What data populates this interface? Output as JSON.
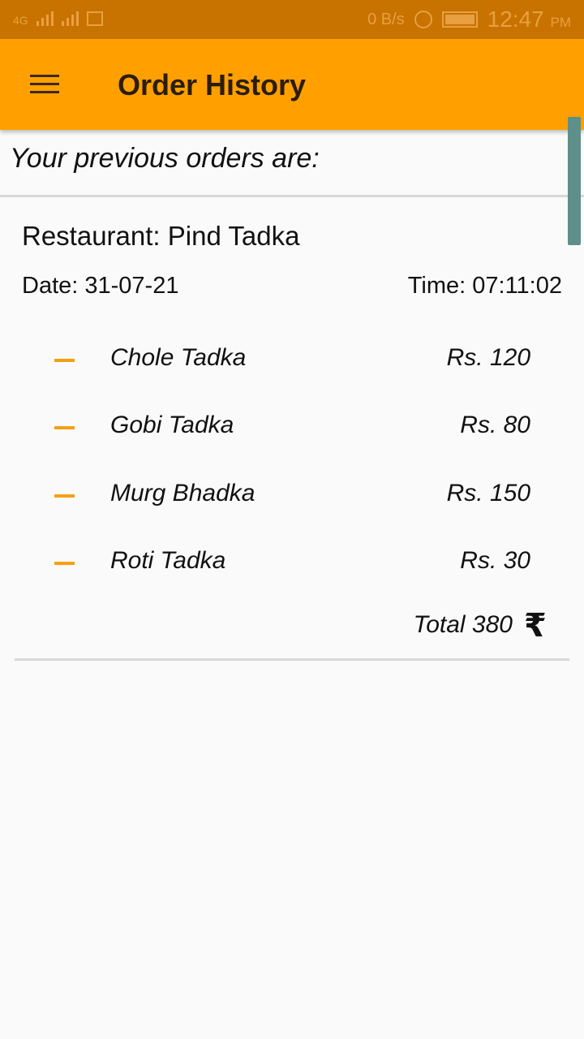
{
  "status_bar": {
    "network": "4G",
    "speed": "0 B/s",
    "time": "12:47",
    "ampm": "PM"
  },
  "app_bar": {
    "title": "Order History",
    "menu_icon": "hamburger-menu-icon"
  },
  "header": {
    "subtitle": "Your previous orders are:"
  },
  "order": {
    "restaurant": "Restaurant: Pind Tadka",
    "date": "Date: 31-07-21",
    "time": "Time: 07:11:02",
    "items": [
      {
        "name": "Chole Tadka",
        "price": "Rs. 120"
      },
      {
        "name": "Gobi Tadka",
        "price": "Rs. 80"
      },
      {
        "name": "Murg Bhadka",
        "price": "Rs. 150"
      },
      {
        "name": "Roti Tadka",
        "price": "Rs. 30"
      }
    ],
    "total": "Total 380",
    "currency_symbol": "₹"
  },
  "colors": {
    "status_bar": "#c87200",
    "app_bar": "#ffa000",
    "accent_dash": "#f5a013",
    "scrollbar": "#5f8f8a"
  }
}
